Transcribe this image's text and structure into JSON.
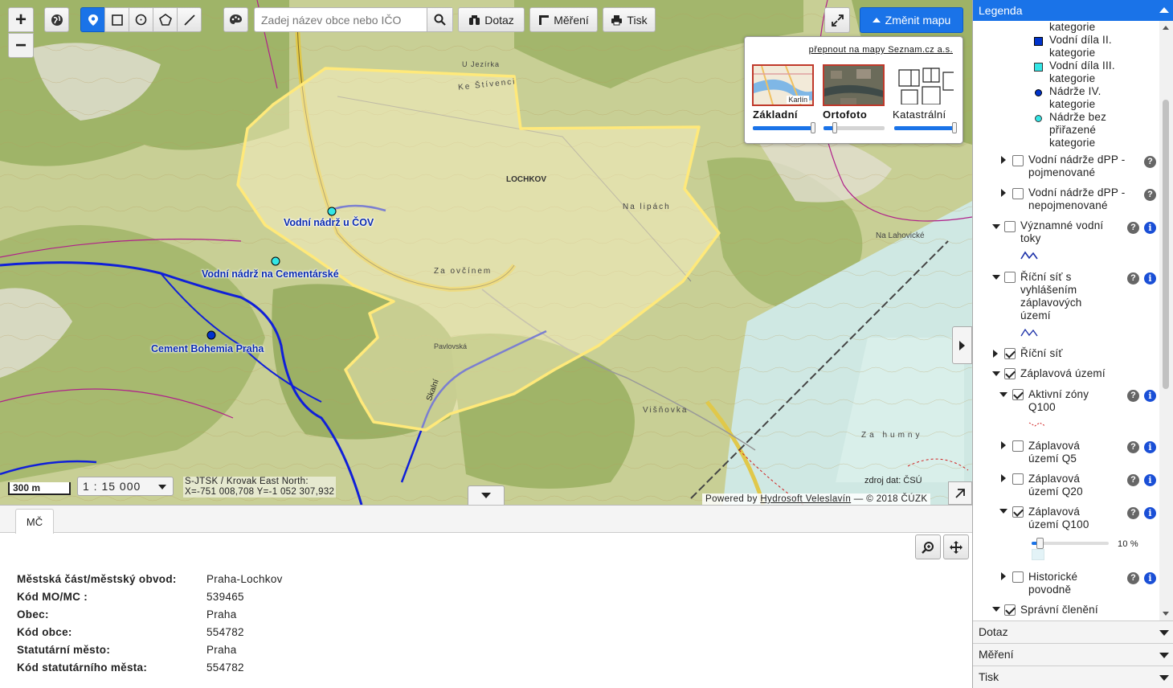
{
  "toolbar": {
    "search_placeholder": "Zadej název obce nebo IČO",
    "dotaz_label": "Dotaz",
    "mereni_label": "Měření",
    "tisk_label": "Tisk",
    "change_map_label": "Změnit mapu",
    "zoom_in_symbol": "+",
    "zoom_out_symbol": "−"
  },
  "basemap_panel": {
    "switch_link": "přepnout na mapy Seznam.cz a.s.",
    "thumb_label_karlin": "Karlín",
    "options": [
      {
        "label": "Základní",
        "opacity": 1.0,
        "selected": true
      },
      {
        "label": "Ortofoto",
        "opacity": 0.2,
        "selected": false
      },
      {
        "label": "Katastrální",
        "opacity": 1.0,
        "selected": false
      }
    ]
  },
  "map": {
    "labels": {
      "cov": "Vodní nádrž u ČOV",
      "cementarske": "Vodní nádrž na Cementárské",
      "cement_bohemia": "Cement Bohemia Praha",
      "lochkov": "LOCHKOV",
      "ke_stivenci": "Ke Štívenci",
      "za_ovcinem": "Za ovčínem",
      "u_jezirka": "U Jezírka",
      "na_lipach": "Na lipách",
      "zahumny": "Za humny",
      "lahovicka": "Na Lahovické",
      "vishovka": "Višňovka",
      "skalni": "Skalní",
      "pavlovska": "Pavlovská"
    },
    "scalebar": "300 m",
    "scale_select": "1 : 15 000",
    "coords_line1": "S-JTSK / Krovak East North:",
    "coords_line2": "X=-751 008,708 Y=-1 052 307,932",
    "source": "zdroj dat: ČSÚ",
    "attribution_prefix": "Powered by",
    "attribution_link": "Hydrosoft Veleslavín",
    "attribution_suffix": "— © 2018 ČÚZK",
    "colors": {
      "boundary": "#ffe97a",
      "rivers": "#1020d8",
      "admin": "#b0208a"
    }
  },
  "info_panel": {
    "tab_label": "MČ",
    "rows": [
      {
        "key": "Městská část/městský obvod:",
        "value": "Praha-Lochkov"
      },
      {
        "key": "Kód MO/MC :",
        "value": "539465"
      },
      {
        "key": "Obec:",
        "value": "Praha"
      },
      {
        "key": "Kód obce:",
        "value": "554782"
      },
      {
        "key": "Statutární město:",
        "value": "Praha"
      },
      {
        "key": "Kód statutárního města:",
        "value": "554782"
      }
    ]
  },
  "legend": {
    "title": "Legenda",
    "top_fragment": "kategorie",
    "vd2_l1": "Vodní díla II.",
    "vd2_l2": "kategorie",
    "vd3_l1": "Vodní díla III.",
    "vd3_l2": "kategorie",
    "n4_l1": "Nádrže IV.",
    "n4_l2": "kategorie",
    "nbez_l1": "Nádrže bez",
    "nbez_l2": "přiřazené",
    "nbez_l3": "kategorie",
    "dpp_pojm_l1": "Vodní nádrže dPP -",
    "dpp_pojm_l2": "pojmenované",
    "dpp_nepojm_l1": "Vodní nádrže dPP -",
    "dpp_nepojm_l2": "nepojmenované",
    "vyzn_l1": "Významné vodní",
    "vyzn_l2": "toky",
    "ricni_zap_l1": "Říční síť s",
    "ricni_zap_l2": "vyhlášením",
    "ricni_zap_l3": "záplavových",
    "ricni_zap_l4": "území",
    "ricni_sit": "Říční síť",
    "zaplavova_uzemi": "Záplavová území",
    "aktivni_l1": "Aktivní zóny",
    "aktivni_l2": "Q100",
    "q5_l1": "Záplavová",
    "q5_l2": "území Q5",
    "q20_l1": "Záplavová",
    "q20_l2": "území Q20",
    "q100_l1": "Záplavová",
    "q100_l2": "území Q100",
    "opacity_value": 0.1,
    "opacity_text": "10 %",
    "historicke_l1": "Historické",
    "historicke_l2": "povodně",
    "spravni": "Správní členění",
    "q_symbol": "?",
    "i_symbol": "i"
  },
  "accordion": {
    "dotaz": "Dotaz",
    "mereni": "Měření",
    "tisk": "Tisk"
  }
}
